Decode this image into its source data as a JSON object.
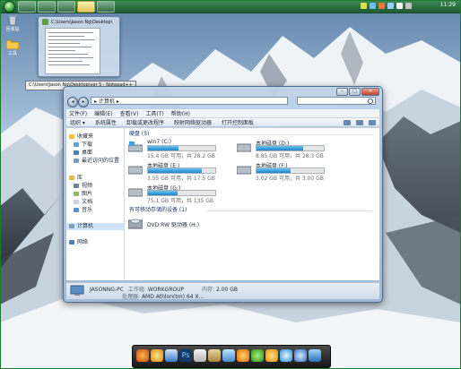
{
  "taskbar": {
    "clock": "11:29",
    "colors": {
      "bar": "#2c6f41",
      "active": "#e0c35a"
    }
  },
  "desktop_icons": [
    {
      "label": "回收站",
      "icon": "recycle-bin-icon"
    },
    {
      "label": "工具",
      "icon": "folder-icon"
    }
  ],
  "preview": {
    "title": "C:\\Users\\Jason Ng\\Desktop\\",
    "tooltip": "C:\\Users\\Jason Ng\\Desktop\\ver 5 - Notepad++"
  },
  "explorer": {
    "breadcrumb": "▸ 计算机 ▸",
    "search_placeholder": "",
    "menu": [
      "文件(F)",
      "编辑(E)",
      "查看(V)",
      "工具(T)",
      "帮助(H)"
    ],
    "commands": [
      "组织 ▾",
      "系统属性",
      "卸载或更改程序",
      "映射网络驱动器",
      "打开控制面板"
    ],
    "nav_pane": {
      "favorites": {
        "label": "收藏夹",
        "items": [
          "下载",
          "桌面",
          "最近访问的位置"
        ]
      },
      "libraries": {
        "label": "库",
        "items": [
          "视频",
          "图片",
          "文档",
          "音乐"
        ]
      },
      "computer": "计算机",
      "network": "网络"
    },
    "hard_disk_group": "硬盘 (5)",
    "drives": [
      {
        "name": "win7 (C:)",
        "free": "15.4 GB 可用，共 28.2 GB",
        "used_fraction": 0.45
      },
      {
        "name": "本地磁盘 (D:)",
        "free": "8.85 GB 可用，共 28.3 GB",
        "used_fraction": 0.69
      },
      {
        "name": "本地磁盘 (E:)",
        "free": "3.55 GB 可用，共 17.5 GB",
        "used_fraction": 0.8
      },
      {
        "name": "本地磁盘 (F:)",
        "free": "3.02 GB 可用，共 3.00 GB",
        "used_fraction": 0.5
      },
      {
        "name": "本地磁盘 (G:)",
        "free": "75.1 GB 可用，共 135 GB",
        "used_fraction": 0.44
      }
    ],
    "removable_group": "有可移动存储的设备 (1)",
    "dvd": {
      "name": "DVD RW 驱动器 (H:)"
    },
    "details": {
      "computer_name": "JASONNG-PC",
      "workgroup_label": "工作组:",
      "workgroup": "WORKGROUP",
      "memory_label": "内存:",
      "memory": "2.00 GB",
      "processor_label": "处理器:",
      "processor": "AMD Athlon(tm) 64 X..."
    }
  },
  "dock": [
    "firefox-icon",
    "media-player-icon",
    "computer-icon",
    "photoshop-icon",
    "paint-icon",
    "notepad-icon",
    "image-viewer-icon",
    "media-icon",
    "chat-icon",
    "browser-icon",
    "qq-icon",
    "network-icon",
    "desktop-icon"
  ]
}
